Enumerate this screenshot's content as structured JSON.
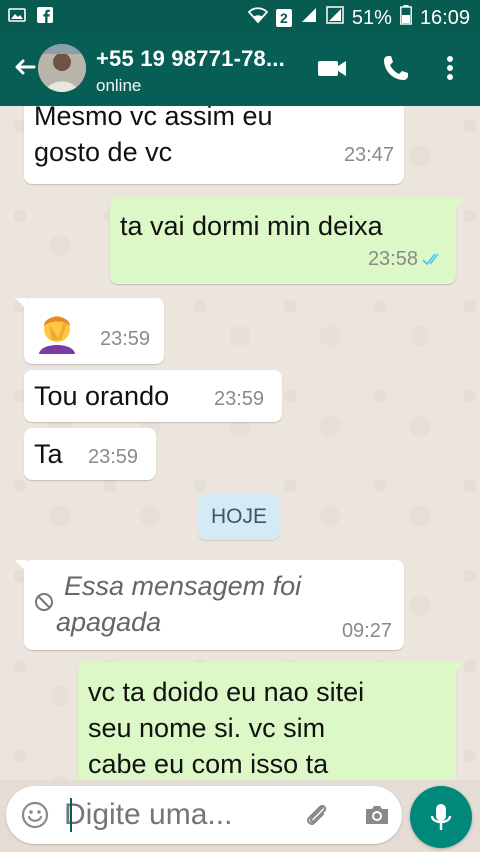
{
  "status_bar": {
    "battery": "51%",
    "time": "16:09",
    "sim_slot": "2"
  },
  "header": {
    "contact_name": "+55 19 98771-78...",
    "status": "online"
  },
  "messages": [
    {
      "direction": "in",
      "text_lines": [
        "Mesmo vc assim eu",
        "gosto de vc"
      ],
      "time": "23:47"
    },
    {
      "direction": "out",
      "text_lines": [
        "ta vai dormi  min deixa"
      ],
      "time": "23:58",
      "read_ticks": "double-blue"
    },
    {
      "direction": "in",
      "emoji": "🤦‍♀️",
      "time": "23:59"
    },
    {
      "direction": "in",
      "text_lines": [
        "Tou orando"
      ],
      "time": "23:59"
    },
    {
      "direction": "in",
      "text_lines": [
        "Ta"
      ],
      "time": "23:59"
    },
    {
      "direction": "in",
      "deleted": true,
      "text_lines": [
        "Essa mensagem foi",
        "apagada"
      ],
      "time": "09:27"
    },
    {
      "direction": "out",
      "text_lines": [
        "vc ta doido eu nao sitei",
        "seu nome  si. vc sim",
        "cabe eu com isso ta"
      ]
    }
  ],
  "date_separator": "HOJE",
  "composer": {
    "placeholder": "Digite uma..."
  },
  "icons": {
    "back": "arrow-left-icon",
    "video_call": "video-camera-icon",
    "voice_call": "phone-icon",
    "menu": "more-vert-icon",
    "emoji": "smiley-icon",
    "attach": "paperclip-icon",
    "camera": "camera-icon",
    "mic": "microphone-icon",
    "deleted": "block-icon"
  },
  "colors": {
    "app_bar": "#075e54",
    "status_bar": "#085b51",
    "outgoing_bubble": "#dcf8c6",
    "incoming_bubble": "#ffffff",
    "mic_button": "#00897b",
    "read_ticks": "#4fc3f7"
  }
}
